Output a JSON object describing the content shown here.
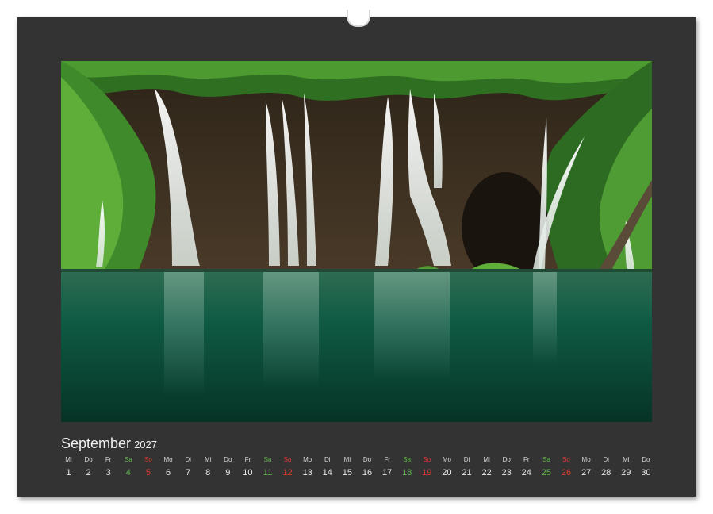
{
  "calendar": {
    "month": "September",
    "year": "2027",
    "weekdays": [
      "Mi",
      "Do",
      "Fr",
      "Sa",
      "So",
      "Mo",
      "Di",
      "Mi",
      "Do",
      "Fr",
      "Sa",
      "So",
      "Mo",
      "Di",
      "Mi",
      "Do",
      "Fr",
      "Sa",
      "So",
      "Mo",
      "Di",
      "Mi",
      "Do",
      "Fr",
      "Sa",
      "So",
      "Mo",
      "Di",
      "Mi",
      "Do"
    ],
    "days": [
      "1",
      "2",
      "3",
      "4",
      "5",
      "6",
      "7",
      "8",
      "9",
      "10",
      "11",
      "12",
      "13",
      "14",
      "15",
      "16",
      "17",
      "18",
      "19",
      "20",
      "21",
      "22",
      "23",
      "24",
      "25",
      "26",
      "27",
      "28",
      "29",
      "30"
    ],
    "saturday_color": "#5fb84a",
    "sunday_color": "#e03a2f"
  },
  "photo": {
    "subject": "waterfall-icon",
    "colors": {
      "foliage": "#3f8a2a",
      "rock": "#3a2c20",
      "water": "#0f5a44",
      "falls": "#f2f4f0"
    }
  },
  "colors": {
    "sheet": "#333333",
    "text": "#f0f0f0"
  }
}
